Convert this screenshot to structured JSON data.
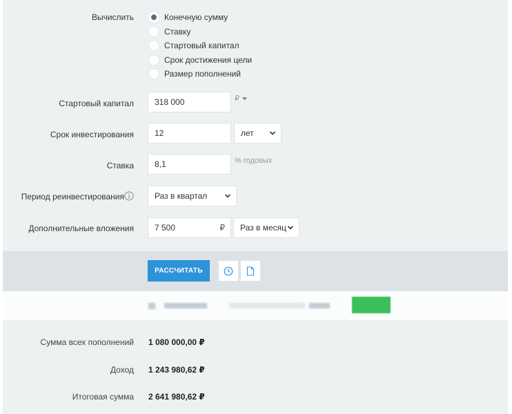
{
  "calculate": {
    "label": "Вычислить",
    "options": [
      "Конечную сумму",
      "Ставку",
      "Стартовый капитал",
      "Срок достижения цели",
      "Размер пополнений"
    ],
    "selected_index": 0
  },
  "start_capital": {
    "label": "Стартовый капитал",
    "value": "318 000",
    "currency": "₽"
  },
  "term": {
    "label": "Срок инвестирования",
    "value": "12",
    "unit": "лет"
  },
  "rate": {
    "label": "Ставка",
    "value": "8,1",
    "suffix": "% годовых"
  },
  "reinvest": {
    "label": "Период реинвестирования",
    "info_icon": "info-icon",
    "value": "Раз в квартал"
  },
  "additions": {
    "label": "Дополнительные вложения",
    "value": "7 500",
    "currency": "₽",
    "period": "Раз в месяц"
  },
  "actions": {
    "calculate_label": "РАССЧИТАТЬ",
    "history_icon": "clock-icon",
    "document_icon": "document-icon"
  },
  "results": {
    "rows": [
      {
        "label": "Сумма всех пополнений",
        "value": "1 080 000,00 ₽"
      },
      {
        "label": "Доход",
        "value": "1 243 980,62 ₽"
      },
      {
        "label": "Итоговая сумма",
        "value": "2 641 980,62 ₽"
      }
    ]
  },
  "colors": {
    "accent": "#2f93d9",
    "panel": "#eef1f2",
    "band": "#dce2e6",
    "green_badge": "#3cbf5a"
  }
}
